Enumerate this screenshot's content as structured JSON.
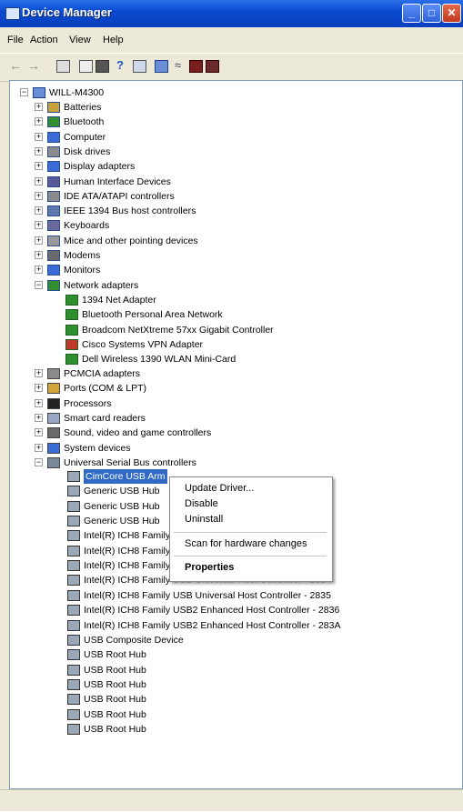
{
  "window": {
    "title": "Device Manager"
  },
  "menu": [
    "File",
    "Action",
    "View",
    "Help"
  ],
  "toolbar_icons": [
    "back-icon",
    "forward-icon",
    "up-icon",
    "properties-icon",
    "print-icon",
    "help-icon",
    "view-icon",
    "computer-icon",
    "scan-icon",
    "uninstall-icon",
    "disable-icon"
  ],
  "tree": {
    "root": "WILL-M4300",
    "items": [
      {
        "label": "Batteries",
        "icon": "battery-icon"
      },
      {
        "label": "Bluetooth",
        "icon": "bluetooth-icon"
      },
      {
        "label": "Computer",
        "icon": "computer-icon"
      },
      {
        "label": "Disk drives",
        "icon": "disk-drive-icon"
      },
      {
        "label": "Display adapters",
        "icon": "display-adapter-icon"
      },
      {
        "label": "Human Interface Devices",
        "icon": "hid-icon"
      },
      {
        "label": "IDE ATA/ATAPI controllers",
        "icon": "ide-icon"
      },
      {
        "label": "IEEE 1394 Bus host controllers",
        "icon": "ieee1394-icon"
      },
      {
        "label": "Keyboards",
        "icon": "keyboard-icon"
      },
      {
        "label": "Mice and other pointing devices",
        "icon": "mouse-icon"
      },
      {
        "label": "Modems",
        "icon": "modem-icon"
      },
      {
        "label": "Monitors",
        "icon": "monitor-icon"
      },
      {
        "label": "Network adapters",
        "icon": "network-adapter-icon",
        "expanded": true
      }
    ],
    "network_children": [
      "1394 Net Adapter",
      "Bluetooth Personal Area Network",
      "Broadcom NetXtreme 57xx Gigabit Controller",
      "Cisco Systems VPN Adapter",
      "Dell Wireless 1390 WLAN Mini-Card"
    ],
    "items2": [
      {
        "label": "PCMCIA adapters",
        "icon": "pcmcia-icon"
      },
      {
        "label": "Ports (COM & LPT)",
        "icon": "port-icon"
      },
      {
        "label": "Processors",
        "icon": "processor-icon"
      },
      {
        "label": "Smart card readers",
        "icon": "smart-card-icon"
      },
      {
        "label": "Sound, video and game controllers",
        "icon": "sound-icon"
      },
      {
        "label": "System devices",
        "icon": "system-device-icon"
      },
      {
        "label": "Universal Serial Bus controllers",
        "icon": "usb-icon",
        "expanded": true
      }
    ],
    "usb_children": [
      "CimCore USB Arm",
      "Generic USB Hub",
      "Generic USB Hub",
      "Generic USB Hub",
      "Intel(R) ICH8 Family USB Universal Host Controller - 2830",
      "Intel(R) ICH8 Family USB Universal Host Controller - 2831",
      "Intel(R) ICH8 Family USB Universal Host Controller - 2832",
      "Intel(R) ICH8 Family USB Universal Host Controller - 2834",
      "Intel(R) ICH8 Family USB Universal Host Controller - 2835",
      "Intel(R) ICH8 Family USB2 Enhanced Host Controller - 2836",
      "Intel(R) ICH8 Family USB2 Enhanced Host Controller - 283A",
      "USB Composite Device",
      "USB Root Hub",
      "USB Root Hub",
      "USB Root Hub",
      "USB Root Hub",
      "USB Root Hub",
      "USB Root Hub"
    ]
  },
  "context_menu": {
    "update_driver": "Update Driver...",
    "disable": "Disable",
    "uninstall": "Uninstall",
    "scan": "Scan for hardware changes",
    "properties": "Properties"
  },
  "colors": {
    "selection": "#316ac5",
    "titlebar": "#0a4bd1"
  }
}
